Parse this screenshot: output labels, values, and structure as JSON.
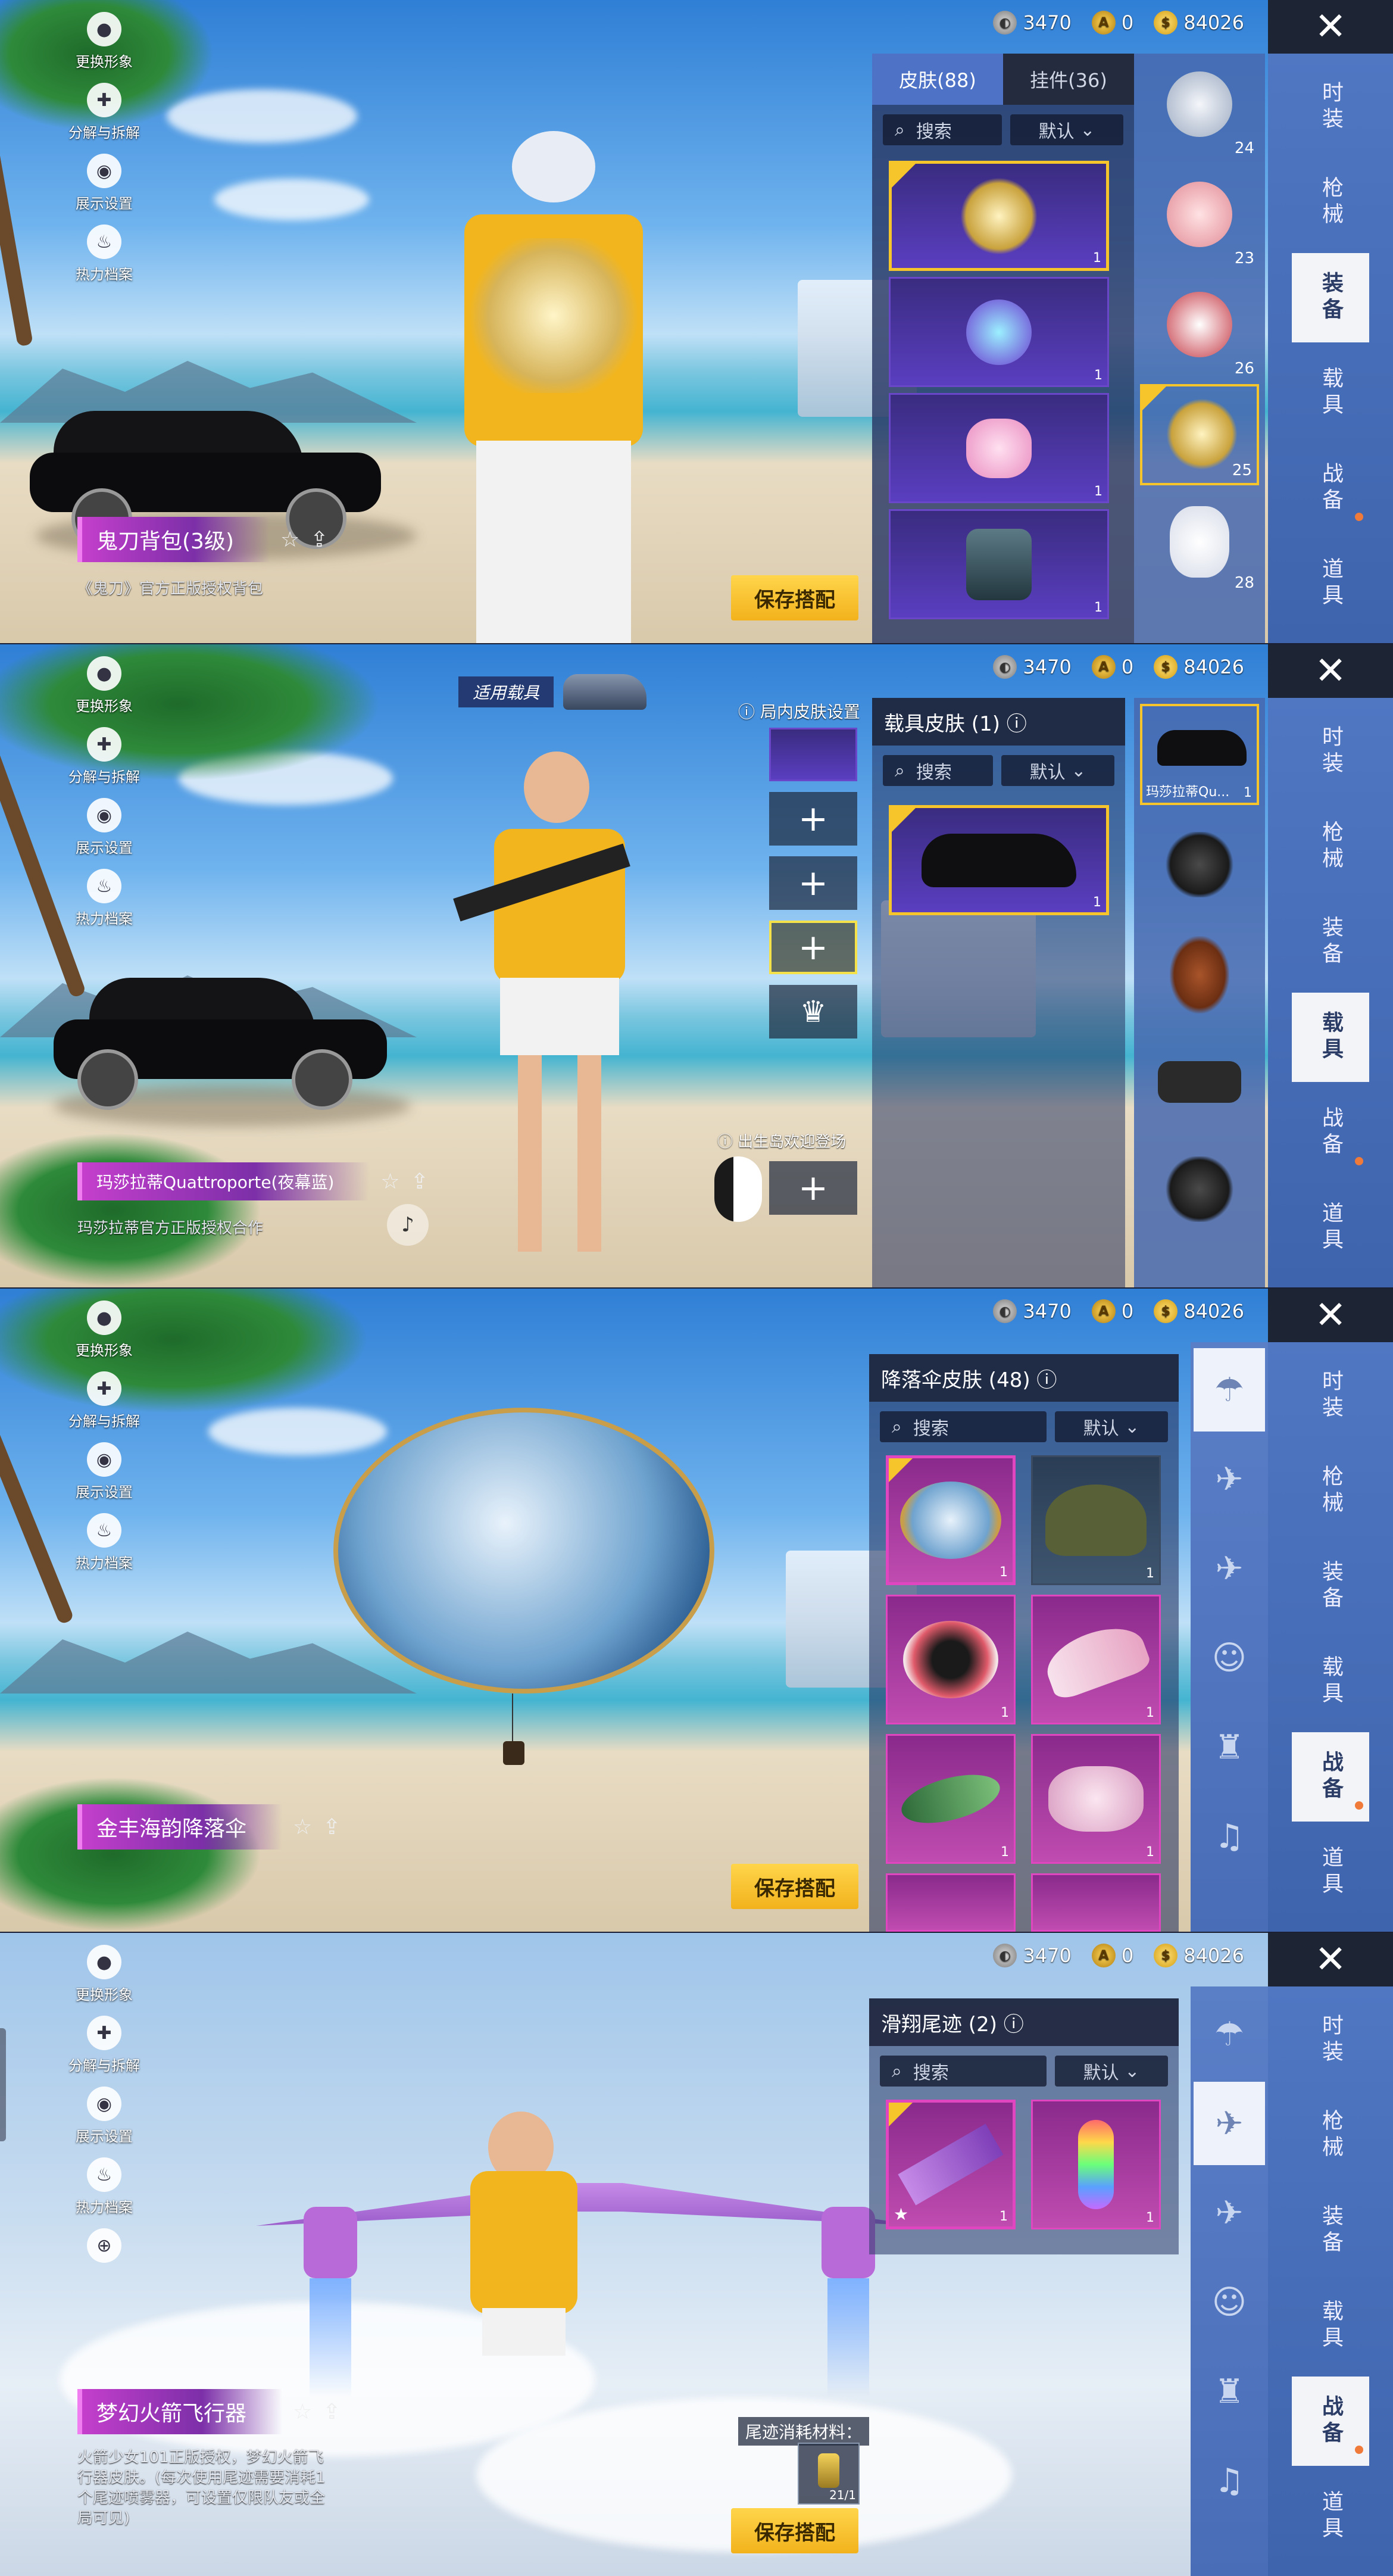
{
  "currency": {
    "silver": "3470",
    "gold": "0",
    "uc": "84026"
  },
  "close_label": "✕",
  "left_menu": [
    {
      "label": "更换形象",
      "icon": "person-icon"
    },
    {
      "label": "分解与拆解",
      "icon": "puzzle-icon"
    },
    {
      "label": "展示设置",
      "icon": "eye-icon"
    },
    {
      "label": "热力档案",
      "icon": "flame-icon"
    }
  ],
  "right_tabs": [
    "时装",
    "枪械",
    "装备",
    "载具",
    "战备",
    "道具"
  ],
  "panel1": {
    "tab_skin": "皮肤(88)",
    "tab_pendant": "挂件(36)",
    "search": "搜索",
    "sort": "默认",
    "items": [
      {
        "qty": "1"
      },
      {
        "qty": "1"
      },
      {
        "qty": "1"
      },
      {
        "qty": "1"
      }
    ],
    "equipped": [
      {
        "num": "24"
      },
      {
        "num": "23"
      },
      {
        "num": "26"
      },
      {
        "num": "25"
      },
      {
        "num": "28"
      }
    ],
    "item_name": "鬼刀背包(3级)",
    "item_desc": "《鬼刀》官方正版授权背包",
    "save": "保存搭配"
  },
  "panel2": {
    "applicable": "适用载具",
    "in_game_setting": "局内皮肤设置",
    "list_title": "载具皮肤 (1)",
    "search": "搜索",
    "sort": "默认",
    "item_qty": "1",
    "equipped_label": "玛莎拉蒂Qu...",
    "equipped_qty": "1",
    "spawn_label": "出生岛欢迎登场",
    "item_name": "玛莎拉蒂Quattroporte(夜幕蓝)",
    "item_desc": "玛莎拉蒂官方正版授权合作"
  },
  "panel3": {
    "list_title": "降落伞皮肤 (48)",
    "search": "搜索",
    "sort": "默认",
    "items": [
      {
        "qty": "1"
      },
      {
        "qty": "1"
      },
      {
        "qty": "1"
      },
      {
        "qty": "1"
      },
      {
        "qty": "1"
      },
      {
        "qty": "1"
      }
    ],
    "item_name": "金丰海韵降落伞",
    "save": "保存搭配"
  },
  "panel4": {
    "list_title": "滑翔尾迹 (2)",
    "search": "搜索",
    "sort": "默认",
    "items": [
      {
        "qty": "1"
      },
      {
        "qty": "1"
      }
    ],
    "item_name": "梦幻火箭飞行器",
    "item_desc": "火箭少女101正版授权，梦幻火箭飞行器皮肤。(每次使用尾迹需要消耗1个尾迹喷雾器，可设置仅限队友或全局可见)",
    "material_label": "尾迹消耗材料：",
    "material_count": "21/1",
    "save": "保存搭配"
  }
}
